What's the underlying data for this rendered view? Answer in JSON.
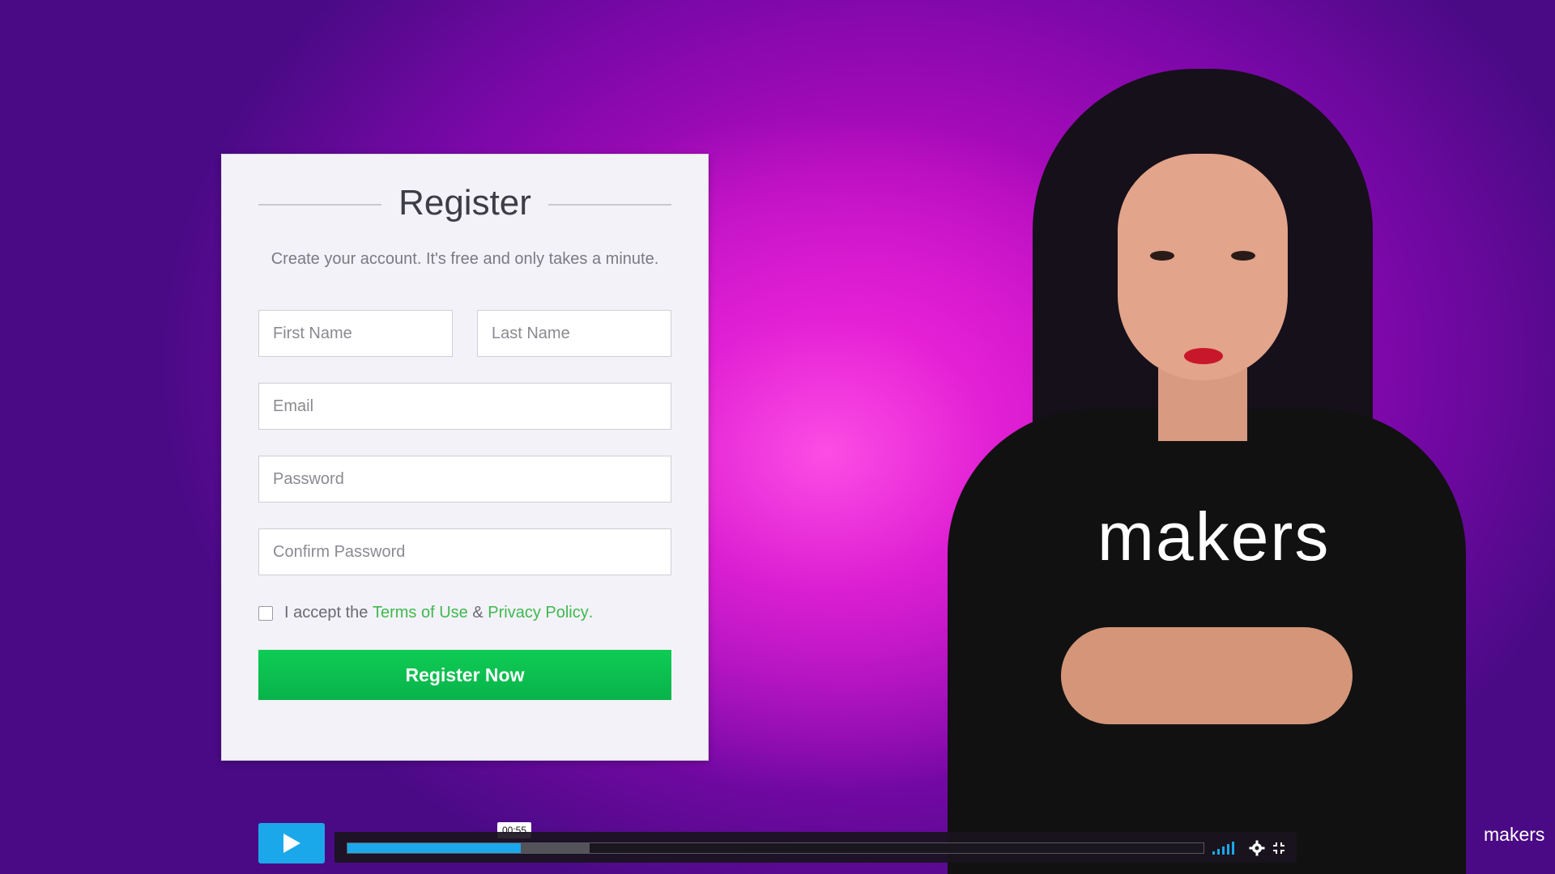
{
  "form": {
    "title": "Register",
    "subtitle": "Create your account. It's free and only takes a minute.",
    "first_name_placeholder": "First Name",
    "last_name_placeholder": "Last Name",
    "email_placeholder": "Email",
    "password_placeholder": "Password",
    "confirm_password_placeholder": "Confirm Password",
    "accept_prefix": "I accept the",
    "terms_link": "Terms of Use",
    "ampersand": "&",
    "privacy_link": "Privacy Policy",
    "period": ".",
    "submit_label": "Register Now"
  },
  "presenter": {
    "shirt_text": "makers"
  },
  "player": {
    "timecode": "00:55",
    "progress_fraction": 0.202,
    "buffered_fraction": 0.283,
    "volume_level_bars": 5
  },
  "watermark": {
    "text": "makers"
  },
  "colors": {
    "accent": "#1aa8ea",
    "button_green": "#0fcc55",
    "link_green": "#3fb84f"
  }
}
